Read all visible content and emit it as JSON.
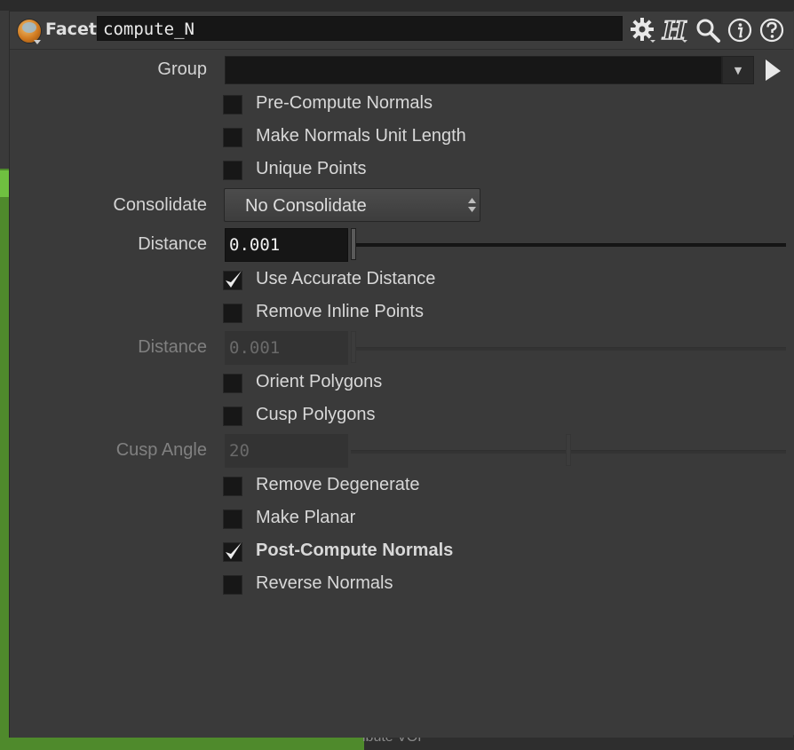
{
  "header": {
    "node_type": "Facet",
    "node_name": "compute_N",
    "icons": [
      "gear-icon",
      "houdini-h-icon",
      "search-icon",
      "info-icon",
      "help-icon"
    ]
  },
  "parameters": {
    "group": {
      "label": "Group",
      "value": ""
    },
    "pre_compute_normals": {
      "label": "Pre-Compute Normals",
      "checked": false
    },
    "make_normals_unit_length": {
      "label": "Make Normals Unit Length",
      "checked": false
    },
    "unique_points": {
      "label": "Unique Points",
      "checked": false
    },
    "consolidate": {
      "label": "Consolidate",
      "value": "No Consolidate"
    },
    "distance": {
      "label": "Distance",
      "value": "0.001"
    },
    "use_accurate_distance": {
      "label": "Use Accurate Distance",
      "checked": true
    },
    "remove_inline_points": {
      "label": "Remove Inline Points",
      "checked": false
    },
    "inline_distance": {
      "label": "Distance",
      "value": "0.001",
      "enabled": false
    },
    "orient_polygons": {
      "label": "Orient Polygons",
      "checked": false
    },
    "cusp_polygons": {
      "label": "Cusp Polygons",
      "checked": false
    },
    "cusp_angle": {
      "label": "Cusp Angle",
      "value": "20",
      "enabled": false
    },
    "remove_degenerate": {
      "label": "Remove Degenerate",
      "checked": false
    },
    "make_planar": {
      "label": "Make Planar",
      "checked": false
    },
    "post_compute_normals": {
      "label": "Post-Compute Normals",
      "checked": true
    },
    "reverse_normals": {
      "label": "Reverse Normals",
      "checked": false
    }
  },
  "background": {
    "bottom_text": "ibute VOP"
  },
  "colors": {
    "panel_bg": "#3a3a3a",
    "field_bg": "#161616",
    "text": "#d8d8d8",
    "disabled_text": "#808080",
    "network_green": "#4f8a2c"
  }
}
